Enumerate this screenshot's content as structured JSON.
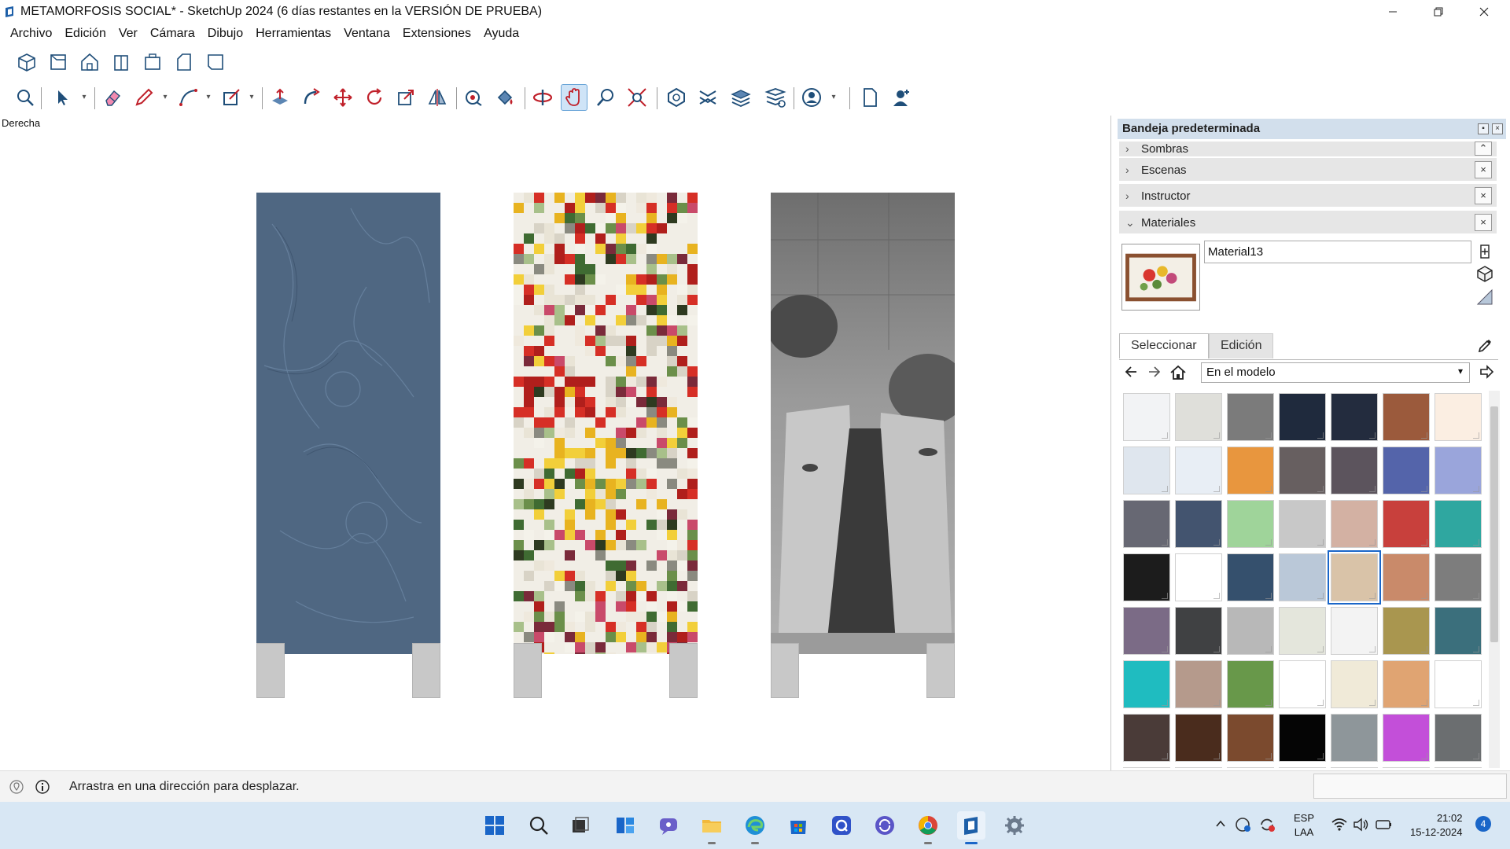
{
  "window": {
    "title": "METAMORFOSIS SOCIAL* - SketchUp 2024 (6 días restantes en la VERSIÓN DE PRUEBA)"
  },
  "menu": [
    "Archivo",
    "Edición",
    "Ver",
    "Cámara",
    "Dibujo",
    "Herramientas",
    "Ventana",
    "Extensiones",
    "Ayuda"
  ],
  "viewport": {
    "view_label": "Derecha",
    "panels": [
      {
        "name": "blue-relief",
        "color": "#4f6782"
      },
      {
        "name": "pixel-flowers",
        "color": "#e8e6df"
      },
      {
        "name": "grayscale-drawing",
        "color": "#8b8b8b"
      }
    ]
  },
  "status": {
    "message": "Arrastra en una dirección para desplazar."
  },
  "tray": {
    "title": "Bandeja predeterminada",
    "sections": [
      {
        "label": "Sombras",
        "expanded": false
      },
      {
        "label": "Escenas",
        "expanded": false
      },
      {
        "label": "Instructor",
        "expanded": false
      },
      {
        "label": "Materiales",
        "expanded": true
      }
    ],
    "materials": {
      "current_name": "Material13",
      "tabs": {
        "select": "Seleccionar",
        "edit": "Edición"
      },
      "collection": "En el modelo",
      "swatches": [
        "#f2f3f5",
        "#dfdfda",
        "#7b7b7b",
        "#1f2a3d",
        "#232c3e",
        "#9b5a3c",
        "#fbeee2",
        "#dfe6ee",
        "#e8eef5",
        "#e8963e",
        "#675f60",
        "#5c545d",
        "#5464aa",
        "#9aa5db",
        "#676873",
        "#43546f",
        "#9fd49a",
        "#c8c8c8",
        "#d3b1a3",
        "#c8403c",
        "#2fa7a0",
        "#1c1c1c",
        "#ffffff",
        "#35506d",
        "#bac8d8",
        "#d9c3a8",
        "#c98a6a",
        "#7d7d7d",
        "#7b6b86",
        "#404143",
        "#b8b8b8",
        "#e4e6dc",
        "#f3f3f3",
        "#a9964f",
        "#3b6f7c",
        "#1fbcc0",
        "#b59a8c",
        "#68984a",
        "#ffffff",
        "#f0ead8",
        "#e0a472",
        "#ffffff",
        "#4a3b38",
        "#4a2c1d",
        "#7b4a2e",
        "#050505",
        "#8e969a",
        "#c34fd9",
        "#6b6e70",
        "#e4e4e4",
        "#9fa4a6",
        "#c7b23b",
        "#dc9b66",
        "#9ba1a3",
        "#a4a6a8",
        "#8f9597"
      ],
      "selected_index": 25
    }
  },
  "taskbar": {
    "lang": {
      "line1": "ESP",
      "line2": "LAA"
    },
    "time": "21:02",
    "date": "15-12-2024",
    "notification_count": "4"
  }
}
